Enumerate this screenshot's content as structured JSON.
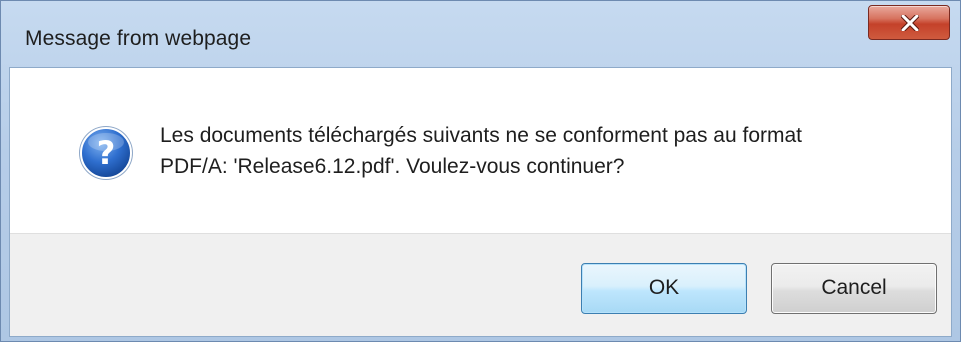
{
  "dialog": {
    "title": "Message from webpage",
    "close_icon": "close-icon",
    "message_icon": "question-icon",
    "message_line1": "Les documents téléchargés suivants ne se conforment pas au format",
    "message_line2": "PDF/A: 'Release6.12.pdf'. Voulez-vous continuer?",
    "ok_label": "OK",
    "cancel_label": "Cancel"
  },
  "colors": {
    "title_bar": "#b6cde8",
    "close_button": "#c4412a",
    "question_icon": "#1c5cb5",
    "ok_border": "#3c7fb1"
  }
}
